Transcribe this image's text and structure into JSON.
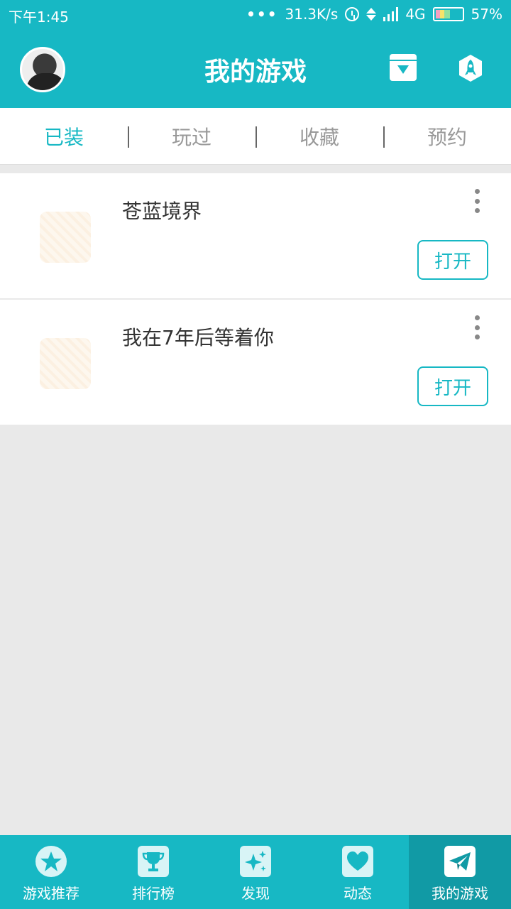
{
  "status_bar": {
    "time": "下午1:45",
    "dots": "•••",
    "network_speed": "31.3K/s",
    "network_type": "4G",
    "battery": "57%",
    "battery_level": 0.57
  },
  "header": {
    "title": "我的游戏",
    "icons": [
      "avatar",
      "download-icon",
      "rocket-icon"
    ]
  },
  "tabs": [
    {
      "label": "已装",
      "active": true
    },
    {
      "label": "玩过",
      "active": false
    },
    {
      "label": "收藏",
      "active": false
    },
    {
      "label": "预约",
      "active": false
    }
  ],
  "games": [
    {
      "name": "苍蓝境界",
      "button": "打开"
    },
    {
      "name": "我在7年后等着你",
      "button": "打开"
    }
  ],
  "bottom_nav": [
    {
      "label": "游戏推荐",
      "icon": "star-icon",
      "active": false
    },
    {
      "label": "排行榜",
      "icon": "trophy-icon",
      "active": false
    },
    {
      "label": "发现",
      "icon": "sparkle-icon",
      "active": false
    },
    {
      "label": "动态",
      "icon": "heart-icon",
      "active": false
    },
    {
      "label": "我的游戏",
      "icon": "paper-plane-icon",
      "active": true
    }
  ],
  "colors": {
    "accent": "#17b8c4",
    "accent_dark": "#119aa5",
    "background": "#e9e9e9"
  }
}
